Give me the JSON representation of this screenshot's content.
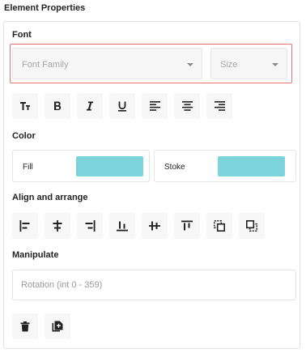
{
  "header": {
    "title": "Element Properties"
  },
  "font": {
    "label": "Font",
    "family": {
      "placeholder": "Font Family"
    },
    "size": {
      "placeholder": "Size"
    },
    "buttons": [
      {
        "name": "text-size-icon",
        "glyph": "TT"
      },
      {
        "name": "bold-icon",
        "glyph": "B"
      },
      {
        "name": "italic-icon",
        "glyph": "I"
      },
      {
        "name": "underline-icon",
        "glyph": "U"
      },
      {
        "name": "align-left-icon"
      },
      {
        "name": "align-center-icon"
      },
      {
        "name": "align-right-icon"
      }
    ]
  },
  "color": {
    "label": "Color",
    "fill": {
      "label": "Fill",
      "value": "#7dd3dc"
    },
    "stroke": {
      "label": "Stoke",
      "value": "#7dd3dc"
    }
  },
  "arrange": {
    "label": "Align and arrange",
    "buttons": [
      "align-left-edges-icon",
      "align-horizontal-center-icon",
      "align-right-edges-icon",
      "align-bottom-edges-icon",
      "align-vertical-center-icon",
      "align-top-edges-icon",
      "send-backward-icon",
      "bring-forward-icon"
    ]
  },
  "manipulate": {
    "label": "Manipulate",
    "rotation": {
      "placeholder": "Rotation (int 0 - 359)"
    },
    "buttons": [
      "delete-icon",
      "duplicate-icon"
    ]
  }
}
